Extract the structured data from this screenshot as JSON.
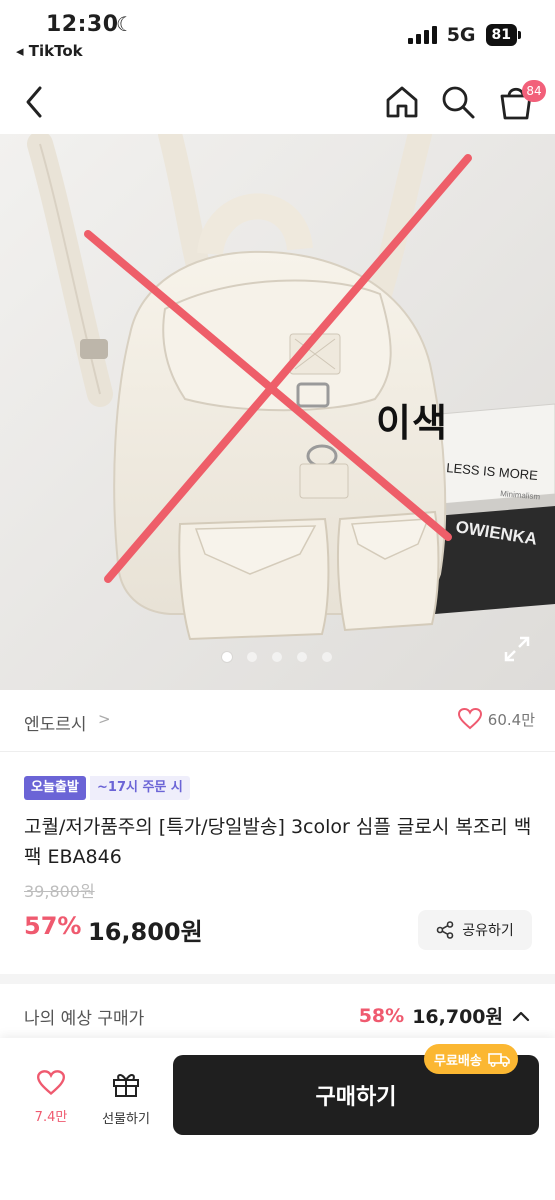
{
  "status_bar": {
    "time": "12:30",
    "back_app": "◂ TikTok",
    "network": "5G",
    "battery": "81"
  },
  "nav": {
    "cart_count": "84"
  },
  "image": {
    "overlay_text": "이색",
    "book1_text": "LESS IS MORE",
    "book1_sub": "Minimalism",
    "book2_text": "OWIENKA",
    "page_dots": 5,
    "active_dot": 1
  },
  "store": {
    "name": "엔도르시",
    "chevron": ">",
    "likes": "60.4만"
  },
  "tags": {
    "today_ship": "오늘출발",
    "deadline": "~17시 주문 시"
  },
  "product": {
    "title": "고퀄/저가품주의 [특가/당일발송] 3color 심플 글로시 복조리 백팩 EBA846",
    "original_price": "39,800원",
    "discount": "57%",
    "price": "16,800원",
    "share_label": "공유하기"
  },
  "expected": {
    "label": "나의 예상 구매가",
    "discount": "58%",
    "price": "16,700원"
  },
  "bottom": {
    "wish_count": "7.4만",
    "gift_label": "선물하기",
    "buy_label": "구매하기",
    "free_ship": "무료배송"
  },
  "colors": {
    "accent_pink": "#ef5a6f",
    "tag_purple": "#6b64d6",
    "ship_yellow": "#fbb732",
    "buy_dark": "#1f1f1f"
  }
}
